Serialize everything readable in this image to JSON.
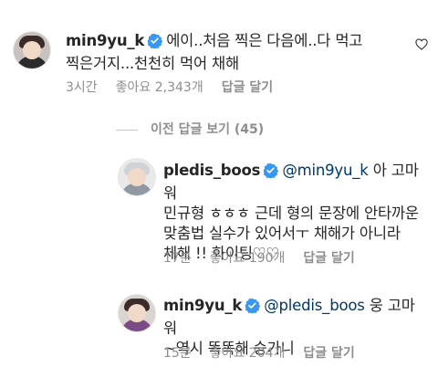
{
  "comments": [
    {
      "username": "min9yu_k",
      "verified": true,
      "text_line1": "에이..처음 찍은 다음에..다 먹고",
      "text_line2": "찍은거지...천천히 먹어 채해",
      "time": "3시간",
      "likes": "좋아요 2,343개",
      "reply": "답글 달기"
    },
    {
      "username": "pledis_boos",
      "verified": true,
      "mention": "@min9yu_k",
      "text_line1_rest": " 아 고마워",
      "text_line2": "민규형 ㅎㅎㅎ 근데 형의 문장에 안타까운",
      "text_line3": "맞춤법 실수가 있어서ㅜ 채해가 아니라",
      "text_line4": "체해 !! 화이팅♡♡",
      "time": "17분",
      "likes": "좋아요 190개",
      "reply": "답글 달기"
    },
    {
      "username": "min9yu_k",
      "verified": true,
      "mention": "@pledis_boos",
      "text_line1_rest": " 웅 고마워",
      "text_line2": "~역시 똑똑해 승가니",
      "time": "15분",
      "likes": "좋아요 204개",
      "reply": "답글 달기"
    }
  ],
  "view_previous": "이전 답글 보기 (45)",
  "icons": {
    "verified": "verified-badge-icon",
    "like": "heart-outline-icon"
  },
  "colors": {
    "verified": "#3897f0",
    "mention": "#00376b",
    "meta": "#8e8e8e"
  }
}
